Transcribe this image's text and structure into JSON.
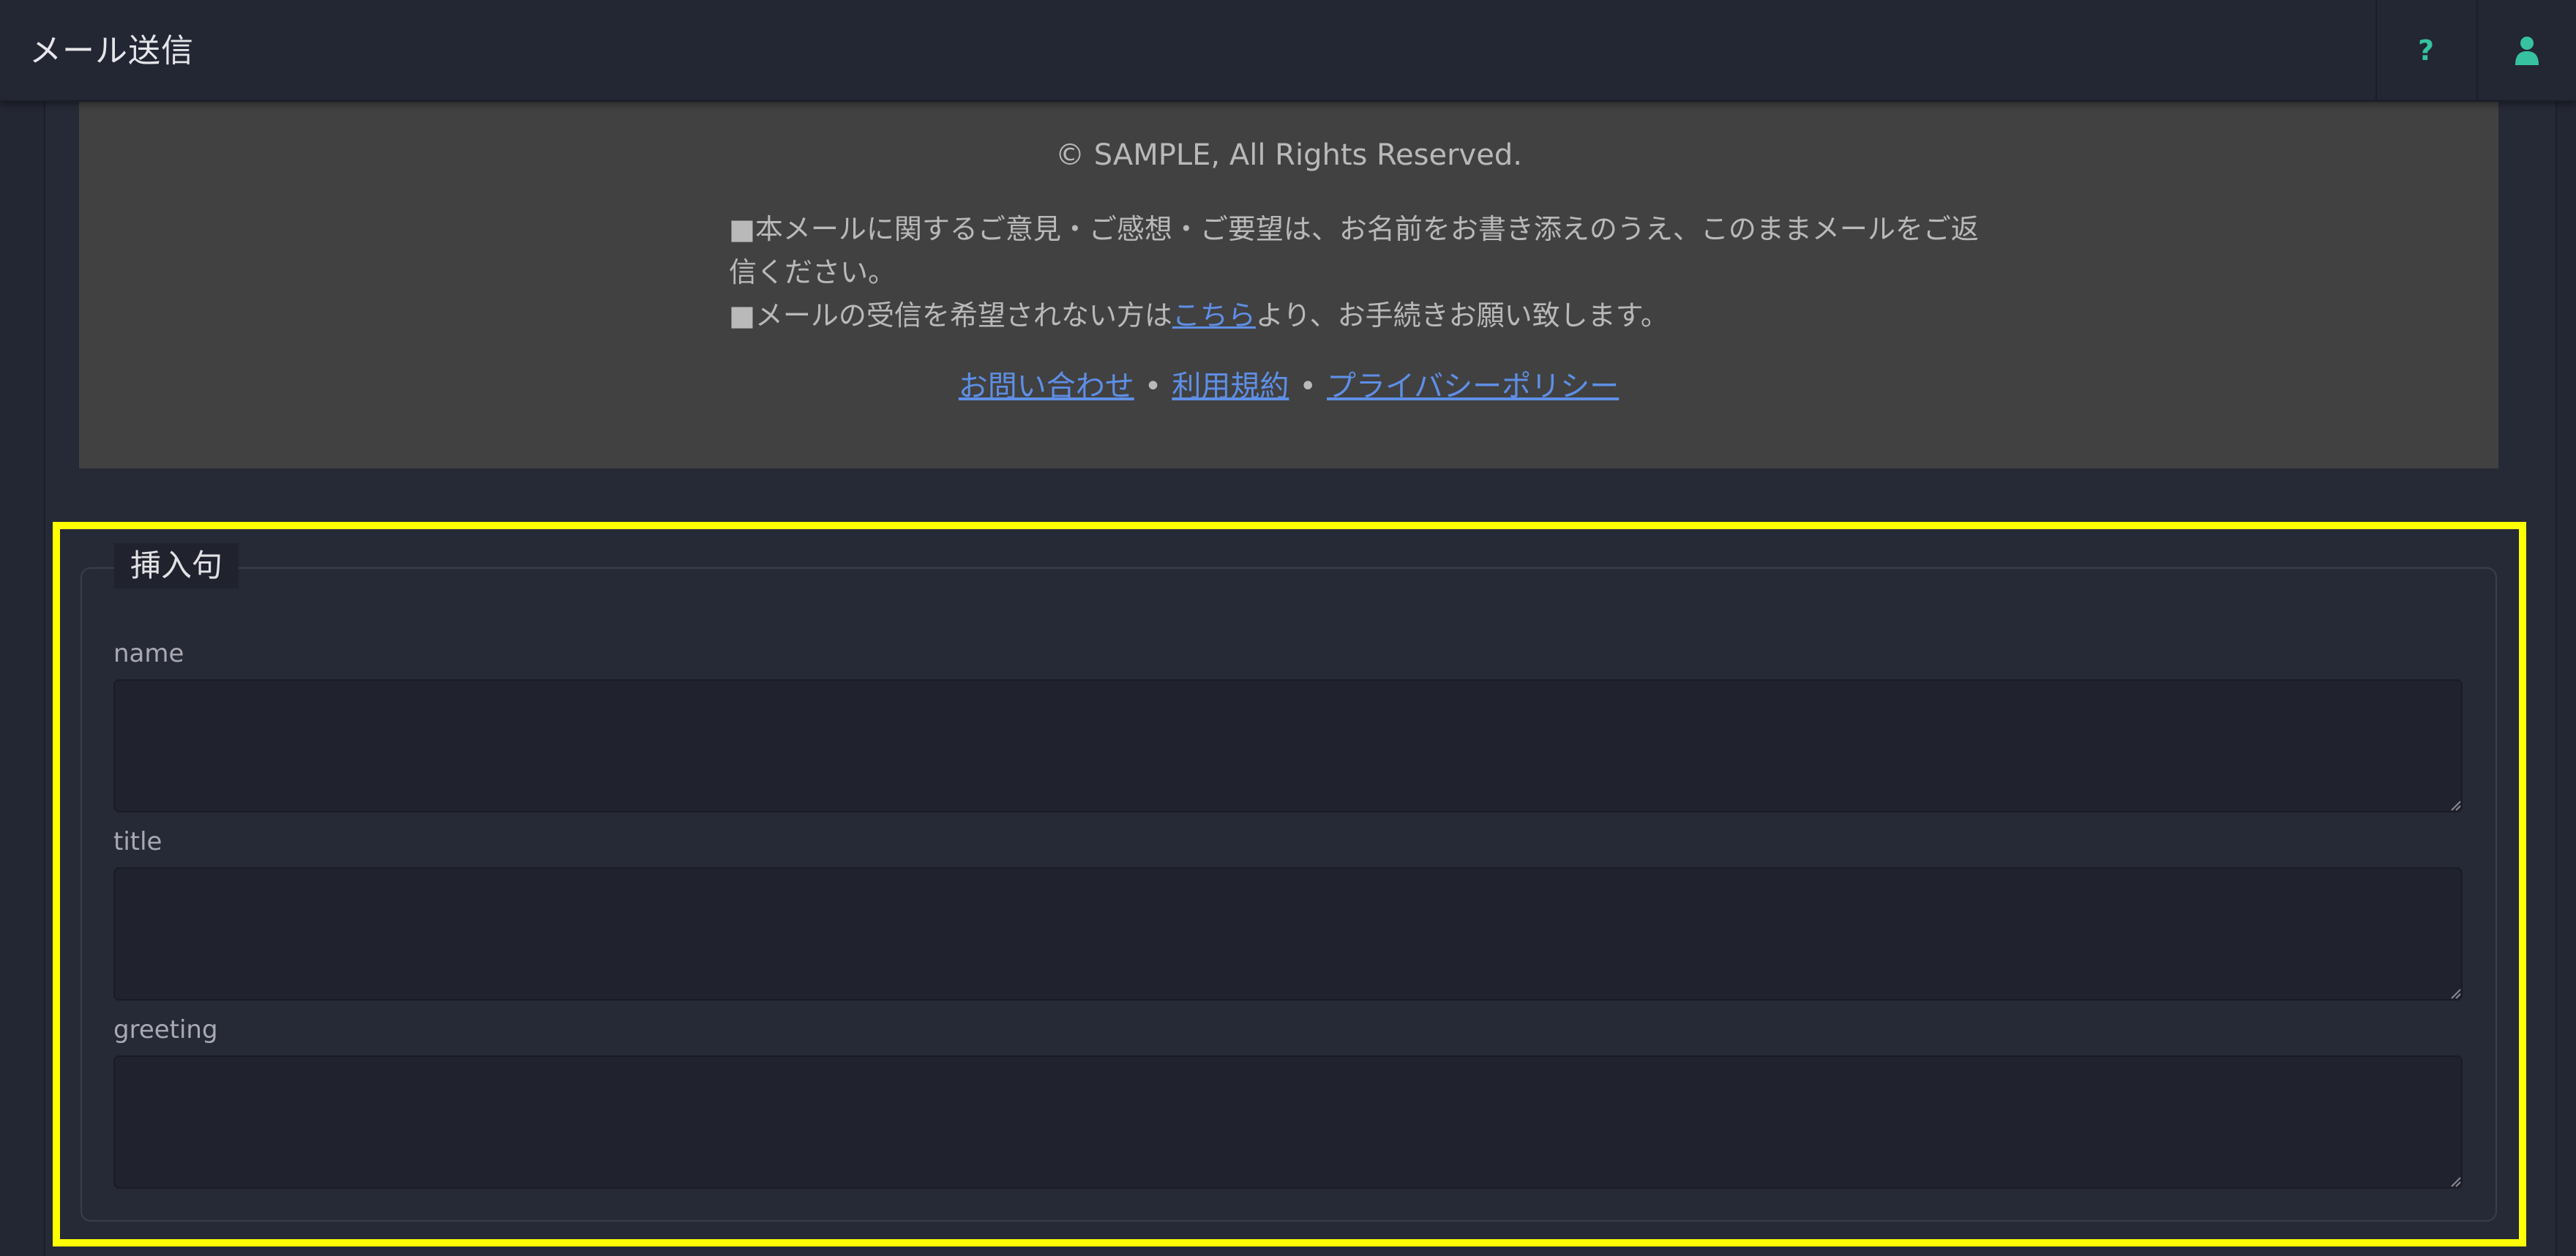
{
  "header": {
    "title": "メール送信",
    "help_icon": "?",
    "user_icon": "user-icon"
  },
  "preview": {
    "copyright": "© SAMPLE, All Rights Reserved.",
    "note1_line1": "■本メールに関するご意見・ご感想・ご要望は、お名前をお書き添えのうえ、このままメールをご返",
    "note1_line2": "信ください。",
    "note2_prefix": "■メールの受信を希望されない方は",
    "note2_link": "こちら",
    "note2_suffix": "より、お手続きお願い致します。",
    "links": {
      "contact": "お問い合わせ",
      "terms": "利用規約",
      "privacy": "プライバシーポリシー",
      "separator": "•"
    }
  },
  "insert_phrases": {
    "legend": "挿入句",
    "fields": [
      {
        "label": "name",
        "value": ""
      },
      {
        "label": "title",
        "value": ""
      },
      {
        "label": "greeting",
        "value": ""
      }
    ]
  },
  "colors": {
    "accent": "#36c2a0",
    "link": "#5e8fe6",
    "highlight": "#ffff00"
  }
}
